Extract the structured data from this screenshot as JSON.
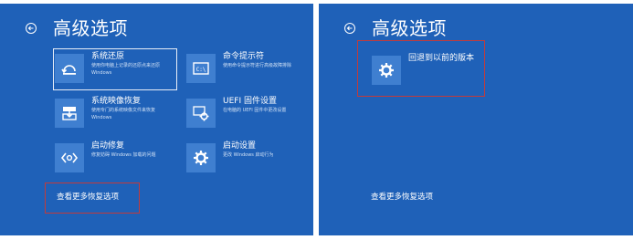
{
  "left": {
    "title": "高级选项",
    "tiles": [
      {
        "icon": "system-restore-icon",
        "title": "系统还原",
        "desc": [
          "使用你电脑上记录的还原点来还原",
          "Windows"
        ]
      },
      {
        "icon": "command-prompt-icon",
        "title": "命令提示符",
        "desc": [
          "使用命令提示符进行高级故障排除"
        ]
      },
      {
        "icon": "system-image-recovery-icon",
        "title": "系统映像恢复",
        "desc": [
          "使用专门的系统映像文件来恢复",
          "Windows"
        ]
      },
      {
        "icon": "uefi-firmware-icon",
        "title": "UEFI 固件设置",
        "desc": [
          "在电脑的 UEFI 固件中更改设置"
        ]
      },
      {
        "icon": "startup-repair-icon",
        "title": "启动修复",
        "desc": [
          "修复妨碍 Windows 加载的问题"
        ]
      },
      {
        "icon": "startup-settings-icon",
        "title": "启动设置",
        "desc": [
          "更改 Windows 启动行为"
        ]
      }
    ],
    "more_link": "查看更多恢复选项"
  },
  "right": {
    "title": "高级选项",
    "tiles": [
      {
        "icon": "gear-icon",
        "title": "回退到以前的版本",
        "desc": []
      }
    ],
    "more_link": "查看更多恢复选项"
  },
  "colors": {
    "panel_bg": "#1f61b8",
    "tile_icon_bg": "#3f7fd0",
    "highlight": "#c23b3b"
  }
}
